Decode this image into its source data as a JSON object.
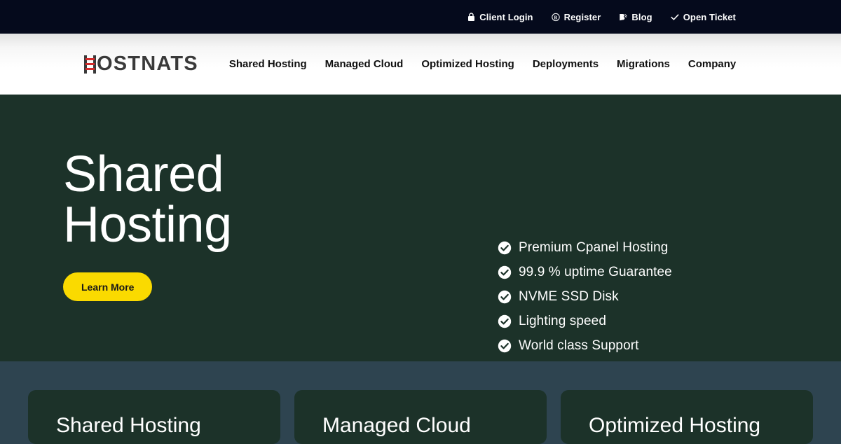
{
  "topbar": {
    "links": [
      {
        "label": "Client Login",
        "icon": "lock-icon"
      },
      {
        "label": "Register",
        "icon": "registered-icon"
      },
      {
        "label": "Blog",
        "icon": "blog-icon"
      },
      {
        "label": "Open Ticket",
        "icon": "check-icon"
      }
    ]
  },
  "header": {
    "logo_text": "OSTNATS",
    "logo_full": "HOSTNATS",
    "nav": [
      {
        "label": "Shared Hosting"
      },
      {
        "label": "Managed Cloud"
      },
      {
        "label": "Optimized Hosting"
      },
      {
        "label": "Deployments"
      },
      {
        "label": "Migrations"
      },
      {
        "label": "Company"
      }
    ]
  },
  "hero": {
    "title_line1": "Shared",
    "title_line2": "Hosting",
    "cta_label": "Learn More",
    "features": [
      {
        "label": "Premium Cpanel Hosting"
      },
      {
        "label": "99.9 % uptime Guarantee"
      },
      {
        "label": "NVME SSD Disk"
      },
      {
        "label": "Lighting speed"
      },
      {
        "label": "World class Support"
      }
    ]
  },
  "cards": [
    {
      "title": "Shared Hosting"
    },
    {
      "title": "Managed Cloud"
    },
    {
      "title": "Optimized Hosting"
    }
  ],
  "colors": {
    "topbar_bg": "#050a1c",
    "header_bg": "#ffffff",
    "hero_bg": "#1c3229",
    "cards_section_bg": "#2e4450",
    "card_bg": "#1c3229",
    "cta_yellow": "#fada00",
    "logo_red": "#d32b2b",
    "logo_gray": "#3a3a3a"
  }
}
